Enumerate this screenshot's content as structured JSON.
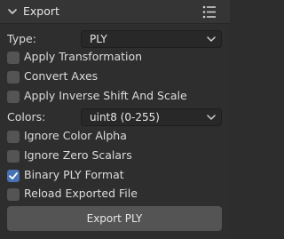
{
  "header": {
    "title": "Export",
    "expanded_icon": "chevron-down-icon",
    "menu_icon": "list-icon"
  },
  "type_field": {
    "label": "Type:",
    "value": "PLY"
  },
  "apply_transformation": {
    "label": "Apply Transformation",
    "checked": false
  },
  "convert_axes": {
    "label": "Convert Axes",
    "checked": false
  },
  "apply_inverse_shift": {
    "label": "Apply Inverse Shift And Scale",
    "checked": false
  },
  "colors_field": {
    "label": "Colors:",
    "value": "uint8 (0-255)"
  },
  "ignore_color_alpha": {
    "label": "Ignore Color Alpha",
    "checked": false
  },
  "ignore_zero_scalars": {
    "label": "Ignore Zero Scalars",
    "checked": false
  },
  "binary_ply_format": {
    "label": "Binary PLY Format",
    "checked": true
  },
  "reload_exported_file": {
    "label": "Reload Exported File",
    "checked": false
  },
  "export_button": {
    "label": "Export PLY"
  },
  "colors": {
    "accent": "#4772b3",
    "panel": "#2e2e2e",
    "button": "#545454"
  }
}
